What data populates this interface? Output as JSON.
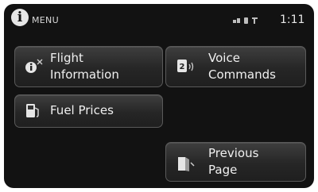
{
  "header": {
    "title": "MENU",
    "time": "1:11",
    "status_icons": [
      "signal-icon",
      "battery-icon",
      "phone-icon"
    ]
  },
  "buttons": {
    "flight_information": "Flight\nInformation",
    "voice_commands": "Voice\nCommands",
    "fuel_prices": "Fuel Prices",
    "previous_page": "Previous\nPage"
  },
  "colors": {
    "screen_bg": "#121212",
    "button_border": "#5a5a5a",
    "text": "#f0f0f0"
  }
}
